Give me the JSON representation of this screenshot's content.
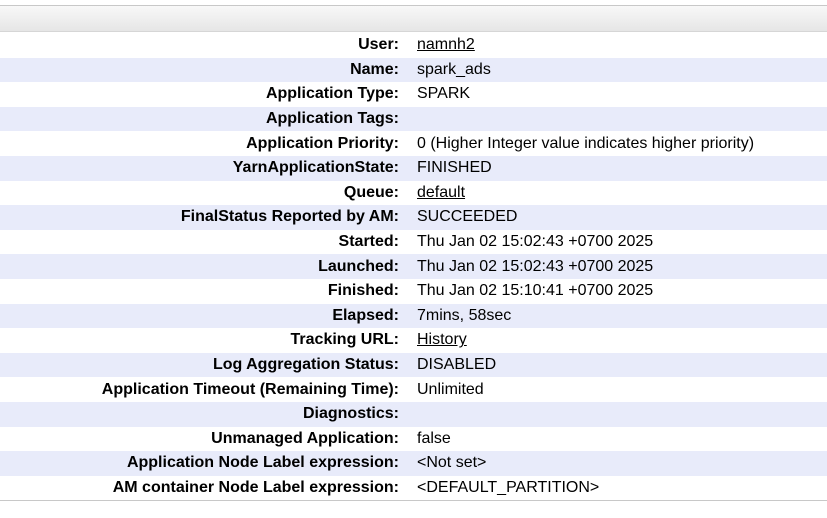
{
  "rows": [
    {
      "label": "User:",
      "value": "namnh2",
      "link": true
    },
    {
      "label": "Name:",
      "value": "spark_ads",
      "link": false
    },
    {
      "label": "Application Type:",
      "value": "SPARK",
      "link": false
    },
    {
      "label": "Application Tags:",
      "value": "",
      "link": false
    },
    {
      "label": "Application Priority:",
      "value": "0 (Higher Integer value indicates higher priority)",
      "link": false
    },
    {
      "label": "YarnApplicationState:",
      "value": "FINISHED",
      "link": false
    },
    {
      "label": "Queue:",
      "value": "default",
      "link": true
    },
    {
      "label": "FinalStatus Reported by AM:",
      "value": "SUCCEEDED",
      "link": false
    },
    {
      "label": "Started:",
      "value": "Thu Jan 02 15:02:43 +0700 2025",
      "link": false
    },
    {
      "label": "Launched:",
      "value": "Thu Jan 02 15:02:43 +0700 2025",
      "link": false
    },
    {
      "label": "Finished:",
      "value": "Thu Jan 02 15:10:41 +0700 2025",
      "link": false
    },
    {
      "label": "Elapsed:",
      "value": "7mins, 58sec",
      "link": false
    },
    {
      "label": "Tracking URL:",
      "value": "History",
      "link": true
    },
    {
      "label": "Log Aggregation Status:",
      "value": "DISABLED",
      "link": false
    },
    {
      "label": "Application Timeout (Remaining Time):",
      "value": "Unlimited",
      "link": false
    },
    {
      "label": "Diagnostics:",
      "value": "",
      "link": false
    },
    {
      "label": "Unmanaged Application:",
      "value": "false",
      "link": false
    },
    {
      "label": "Application Node Label expression:",
      "value": "<Not set>",
      "link": false
    },
    {
      "label": "AM container Node Label expression:",
      "value": "<DEFAULT_PARTITION>",
      "link": false
    }
  ],
  "colors": {
    "stripe": "#e8ebfa",
    "header_gradient_top": "#f8f8f8",
    "header_gradient_bottom": "#e6e6e6"
  }
}
